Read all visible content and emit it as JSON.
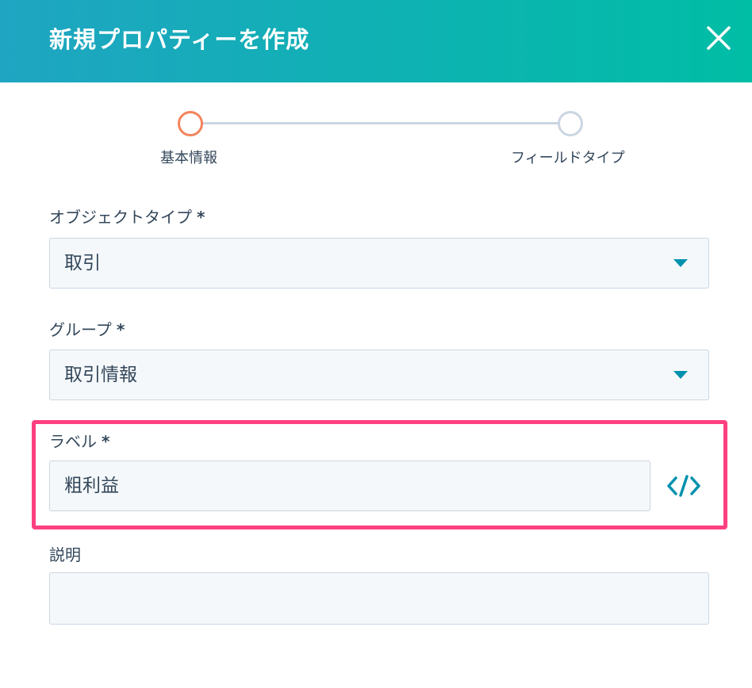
{
  "header": {
    "title": "新規プロパティーを作成"
  },
  "steps": [
    {
      "label": "基本情報"
    },
    {
      "label": "フィールドタイプ"
    }
  ],
  "fields": {
    "object_type": {
      "label": "オブジェクトタイプ",
      "required": "*",
      "value": "取引"
    },
    "group": {
      "label": "グループ",
      "required": "*",
      "value": "取引情報"
    },
    "label": {
      "label": "ラベル",
      "required": "*",
      "value": "粗利益"
    },
    "description": {
      "label": "説明",
      "value": ""
    }
  },
  "colors": {
    "header_start": "#1fa5c2",
    "header_end": "#00bda5",
    "active_step": "#f2845c",
    "inactive_step": "#cbd6e2",
    "highlight": "#ff3f80",
    "accent": "#0091ae"
  },
  "icons": {
    "close": "close-icon",
    "code": "code-icon",
    "caret": "caret-down-icon"
  }
}
